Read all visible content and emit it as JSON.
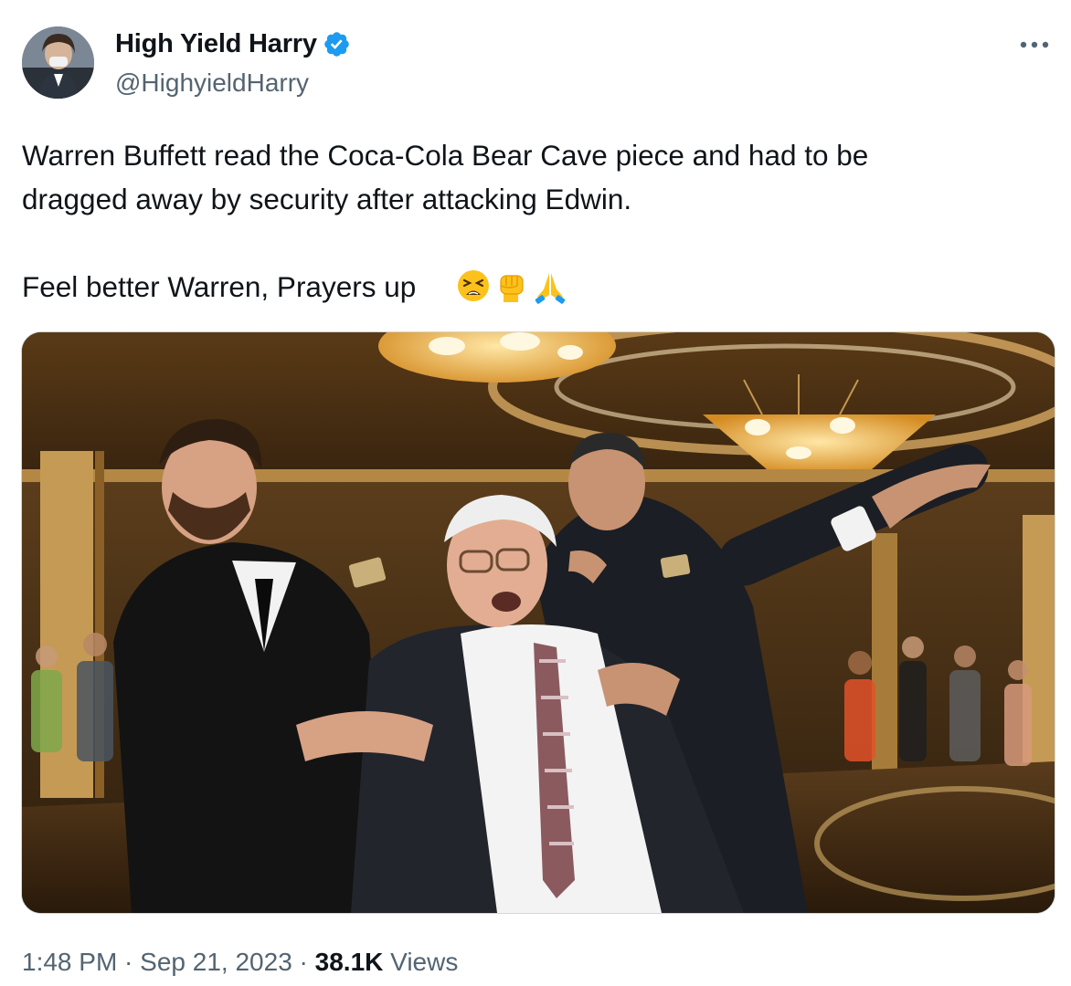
{
  "author": {
    "display_name": "High Yield Harry",
    "handle": "@HighyieldHarry",
    "verified": true,
    "avatar_icon": "user-avatar"
  },
  "more_menu_icon": "more-icon",
  "tweet_text": {
    "line1": "Warren Buffett read the Coca-Cola Bear Cave piece and had to be",
    "line2": "dragged away by security after attacking Edwin.",
    "line3": "Feel better Warren, Prayers up",
    "emojis": [
      "tired-face-emoji",
      "raised-fist-emoji",
      "folded-hands-emoji"
    ]
  },
  "meta": {
    "time": "1:48 PM",
    "separator": " · ",
    "date": "Sep 21, 2023",
    "views_count": "38.1K",
    "views_label": " Views"
  },
  "colors": {
    "text": "#0f1419",
    "secondary": "#536471",
    "verified_blue": "#1d9bf0",
    "border": "#cfd9de"
  }
}
